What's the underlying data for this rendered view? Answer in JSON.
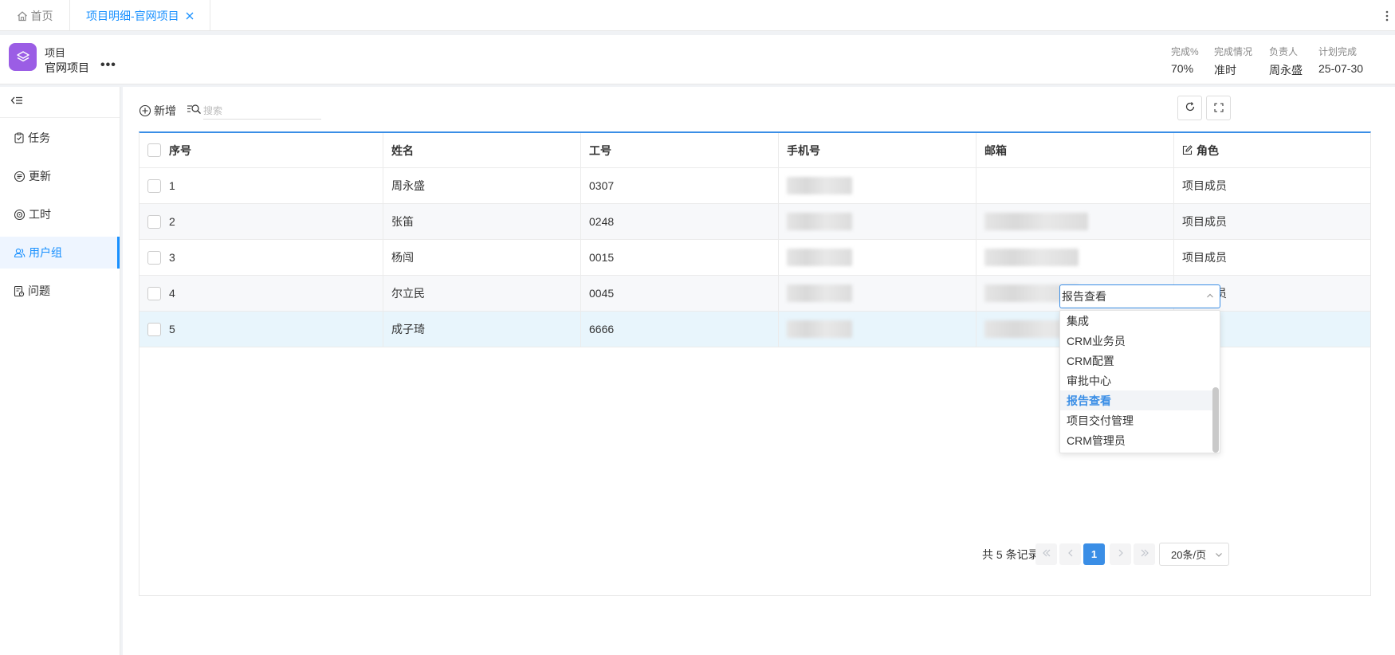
{
  "tabs": [
    {
      "label": "首页",
      "icon": "home-icon"
    },
    {
      "label": "项目明细-官网项目",
      "icon": "close-icon"
    }
  ],
  "project": {
    "type_label": "项目",
    "name": "官网项目",
    "more": "•••",
    "logo_color": "#9b5de5",
    "stats": [
      {
        "label": "完成%",
        "value": "70%"
      },
      {
        "label": "完成情况",
        "value": "准时"
      },
      {
        "label": "负责人",
        "value": "周永盛"
      },
      {
        "label": "计划完成",
        "value": "25-07-30"
      }
    ]
  },
  "sidebar": {
    "items": [
      {
        "label": "任务",
        "icon": "task-icon"
      },
      {
        "label": "更新",
        "icon": "update-icon"
      },
      {
        "label": "工时",
        "icon": "timer-icon"
      },
      {
        "label": "用户组",
        "icon": "user-group-icon",
        "active": true
      },
      {
        "label": "问题",
        "icon": "issue-icon"
      }
    ]
  },
  "toolbar": {
    "add_label": "新增",
    "search_placeholder": "搜索"
  },
  "table": {
    "columns": [
      "序号",
      "姓名",
      "工号",
      "手机号",
      "邮箱",
      "角色"
    ],
    "rows": [
      {
        "no": "1",
        "name": "周永盛",
        "emp_id": "0307",
        "role": "项目成员"
      },
      {
        "no": "2",
        "name": "张笛",
        "emp_id": "0248",
        "role": "项目成员"
      },
      {
        "no": "3",
        "name": "杨闯",
        "emp_id": "0015",
        "role": "项目成员"
      },
      {
        "no": "4",
        "name": "尔立民",
        "emp_id": "0045",
        "role": "项目成员"
      },
      {
        "no": "5",
        "name": "成子琦",
        "emp_id": "6666",
        "role": "报告查看"
      }
    ]
  },
  "role_select": {
    "value": "报告查看",
    "options": [
      "集成",
      "CRM业务员",
      "CRM配置",
      "审批中心",
      "报告查看",
      "项目交付管理",
      "CRM管理员"
    ],
    "selected_index": 4
  },
  "pagination": {
    "total_text": "共 5 条记录",
    "current_page": "1",
    "page_size": "20条/页"
  },
  "colors": {
    "accent": "#1890ff",
    "primary_button": "#3a8ee6"
  }
}
